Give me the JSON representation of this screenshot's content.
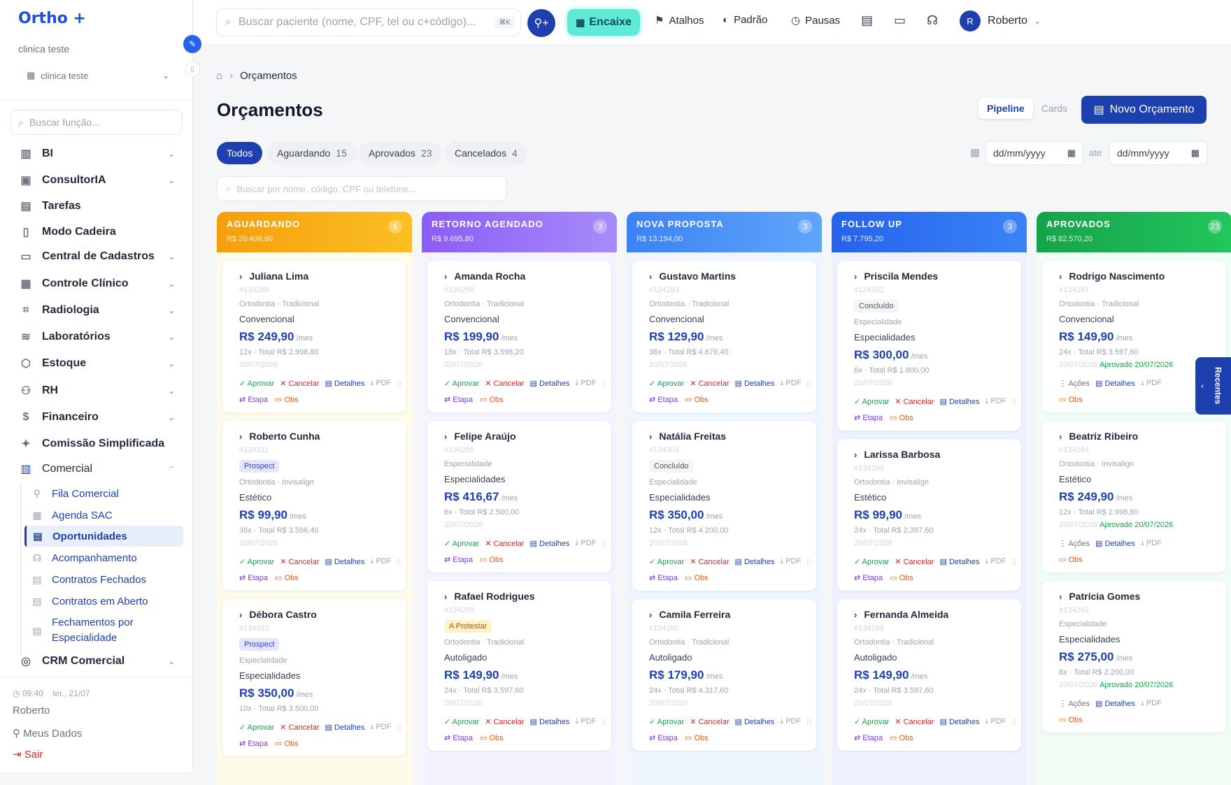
{
  "sidebar": {
    "logo": "Ortho +",
    "clinic_name": "clinica teste",
    "clinic_select": "clinica teste",
    "search_placeholder": "Buscar função...",
    "menu": [
      {
        "label": "BI",
        "icon": "bar-chart-icon"
      },
      {
        "label": "ConsultorIA",
        "icon": "briefcase-icon"
      },
      {
        "label": "Tarefas",
        "icon": "clipboard-icon"
      },
      {
        "label": "Modo Cadeira",
        "icon": "tablet-icon"
      },
      {
        "label": "Central de Cadastros",
        "icon": "folder-icon"
      },
      {
        "label": "Controle Clínico",
        "icon": "calendar-icon"
      },
      {
        "label": "Radiologia",
        "icon": "scan-icon"
      },
      {
        "label": "Laboratórios",
        "icon": "layers-icon"
      },
      {
        "label": "Estoque",
        "icon": "box-icon"
      },
      {
        "label": "RH",
        "icon": "users-icon"
      },
      {
        "label": "Financeiro",
        "icon": "dollar-icon"
      },
      {
        "label": "Comissão Simplificada",
        "icon": "sparkle-icon"
      },
      {
        "label": "Comercial",
        "icon": "building-icon"
      }
    ],
    "submenu": [
      {
        "label": "Fila Comercial",
        "icon": "user-icon"
      },
      {
        "label": "Agenda SAC",
        "icon": "calendar-icon"
      },
      {
        "label": "Oportunidades",
        "icon": "document-icon"
      },
      {
        "label": "Acompanhamento",
        "icon": "headset-icon"
      },
      {
        "label": "Contratos Fechados",
        "icon": "document-check-icon"
      },
      {
        "label": "Contratos em Aberto",
        "icon": "document-open-icon"
      },
      {
        "label_line1": "Fechamentos por",
        "label_line2": "Especialidade",
        "icon": "document-icon"
      }
    ],
    "crm": "CRM Comercial",
    "footer": {
      "time": "09:40",
      "date": "ter., 21/07",
      "user": "Roberto",
      "meus_dados": "Meus Dados",
      "sair": "Sair"
    }
  },
  "topbar": {
    "search_placeholder": "Buscar paciente (nome, CPF, tel ou c+código)...",
    "shortcut": "⌘K",
    "encaixe": "Encaixe",
    "atalhos": "Atalhos",
    "padrao": "Padrão",
    "pausas": "Pausas",
    "user_initial": "R",
    "user_name": "Roberto"
  },
  "breadcrumb": {
    "current": "Orçamentos"
  },
  "page": {
    "title": "Orçamentos",
    "view_pipeline": "Pipeline",
    "view_cards": "Cards",
    "novo_button": "Novo Orçamento"
  },
  "filters": {
    "todos": "Todos",
    "aguardando": "Aguardando",
    "aguardando_count": "15",
    "aprovados": "Aprovados",
    "aprovados_count": "23",
    "cancelados": "Cancelados",
    "cancelados_count": "4",
    "date_from": "dd/mm/yyyy",
    "date_to": "dd/mm/yyyy",
    "ate": "ate",
    "search_placeholder": "Buscar por nome, código, CPF ou telefone..."
  },
  "actions": {
    "aprovar": "Aprovar",
    "cancelar": "Cancelar",
    "detalhes": "Detalhes",
    "pdf": "PDF",
    "etapa": "Etapa",
    "obs": "Obs",
    "acoes": "Ações",
    "mes": "/mes"
  },
  "colors": {
    "aguardando": "#f59e0b",
    "retorno": "#8b5cf6",
    "nova": "#3b82f6",
    "followup": "#2563eb",
    "aprovados": "#22c55e",
    "primary": "#1e40af"
  },
  "recentes": "Recentes",
  "columns": [
    {
      "title": "AGUARDANDO",
      "total": "R$ 20.408,60",
      "count": "6",
      "cards": [
        {
          "name": "Juliana Lima",
          "code": "#134286",
          "badge": "",
          "spec": "Ortodontia · Tradicional",
          "type": "Convencional",
          "price": "R$ 249,90",
          "total": "12x · Total R$ 2.998,80",
          "date": "20/07/2026"
        },
        {
          "name": "Roberto Cunha",
          "code": "#134311",
          "badge": "Prospect",
          "spec": "Ortodontia · Invisalign",
          "type": "Estético",
          "price": "R$ 99,90",
          "total": "36x · Total R$ 3.596,40",
          "date": "20/07/2026"
        },
        {
          "name": "Débora Castro",
          "code": "#134310",
          "badge": "Prospect",
          "spec": "Especialidade",
          "type": "Especialidades",
          "price": "R$ 350,00",
          "total": "10x · Total R$ 3.500,00",
          "date": ""
        }
      ]
    },
    {
      "title": "RETORNO AGENDADO",
      "total": "R$ 9.695,80",
      "count": "3",
      "cards": [
        {
          "name": "Amanda Rocha",
          "code": "#134298",
          "badge": "",
          "spec": "Ortodontia · Tradicional",
          "type": "Convencional",
          "price": "R$ 199,90",
          "total": "18x · Total R$ 3.598,20",
          "date": "20/07/2026"
        },
        {
          "name": "Felipe Araújo",
          "code": "#134295",
          "badge": "",
          "spec": "Especialidade",
          "type": "Especialidades",
          "price": "R$ 416,67",
          "total": "6x · Total R$ 2.500,00",
          "date": "20/07/2026"
        },
        {
          "name": "Rafael Rodrigues",
          "code": "#134289",
          "badge": "A Protestar",
          "spec": "Ortodontia · Tradicional",
          "type": "Autoligado",
          "price": "R$ 149,90",
          "total": "24x · Total R$ 3.597,60",
          "date": "20/07/2026"
        }
      ]
    },
    {
      "title": "NOVA PROPOSTA",
      "total": "R$ 13.194,00",
      "count": "3",
      "cards": [
        {
          "name": "Gustavo Martins",
          "code": "#134293",
          "badge": "",
          "spec": "Ortodontia · Tradicional",
          "type": "Convencional",
          "price": "R$ 129,90",
          "total": "36x · Total R$ 4.676,40",
          "date": "20/07/2026"
        },
        {
          "name": "Natália Freitas",
          "code": "#134304",
          "badge": "Concluído",
          "spec": "Especialidade",
          "type": "Especialidades",
          "price": "R$ 350,00",
          "total": "12x · Total R$ 4.200,00",
          "date": "20/07/2026"
        },
        {
          "name": "Camila Ferreira",
          "code": "#134290",
          "badge": "",
          "spec": "Ortodontia · Tradicional",
          "type": "Autoligado",
          "price": "R$ 179,90",
          "total": "24x · Total R$ 4.317,60",
          "date": "20/07/2026"
        }
      ]
    },
    {
      "title": "FOLLOW UP",
      "total": "R$ 7.795,20",
      "count": "3",
      "cards": [
        {
          "name": "Priscila Mendes",
          "code": "#134302",
          "badge": "Concluído",
          "spec": "Especialidade",
          "type": "Especialidades",
          "price": "R$ 300,00",
          "total": "6x · Total R$ 1.800,00",
          "date": "20/07/2026"
        },
        {
          "name": "Larissa Barbosa",
          "code": "#134296",
          "badge": "",
          "spec": "Ortodontia · Invisalign",
          "type": "Estético",
          "price": "R$ 99,90",
          "total": "24x · Total R$ 2.397,60",
          "date": "20/07/2026"
        },
        {
          "name": "Fernanda Almeida",
          "code": "#134288",
          "badge": "",
          "spec": "Ortodontia · Tradicional",
          "type": "Autoligado",
          "price": "R$ 149,90",
          "total": "24x · Total R$ 3.597,60",
          "date": "20/07/2026"
        }
      ]
    },
    {
      "title": "APROVADOS",
      "total": "R$ 82.570,20",
      "count": "23",
      "cards": [
        {
          "name": "Rodrigo Nascimento",
          "code": "#134297",
          "badge": "",
          "spec": "Ortodontia · Tradicional",
          "type": "Convencional",
          "price": "R$ 149,90",
          "total": "24x · Total R$ 3.597,60",
          "date": "20/07/2026",
          "approved": "Aprovado 20/07/2026"
        },
        {
          "name": "Beatriz Ribeiro",
          "code": "#134294",
          "badge": "",
          "spec": "Ortodontia · Invisalign",
          "type": "Estético",
          "price": "R$ 249,90",
          "total": "12x · Total R$ 2.998,80",
          "date": "20/07/2026",
          "approved": "Aprovado 20/07/2026"
        },
        {
          "name": "Patrícia Gomes",
          "code": "#134292",
          "badge": "",
          "spec": "Especialidade",
          "type": "Especialidades",
          "price": "R$ 275,00",
          "total": "8x · Total R$ 2.200,00",
          "date": "20/07/2026",
          "approved": "Aprovado 20/07/2026"
        }
      ]
    }
  ]
}
